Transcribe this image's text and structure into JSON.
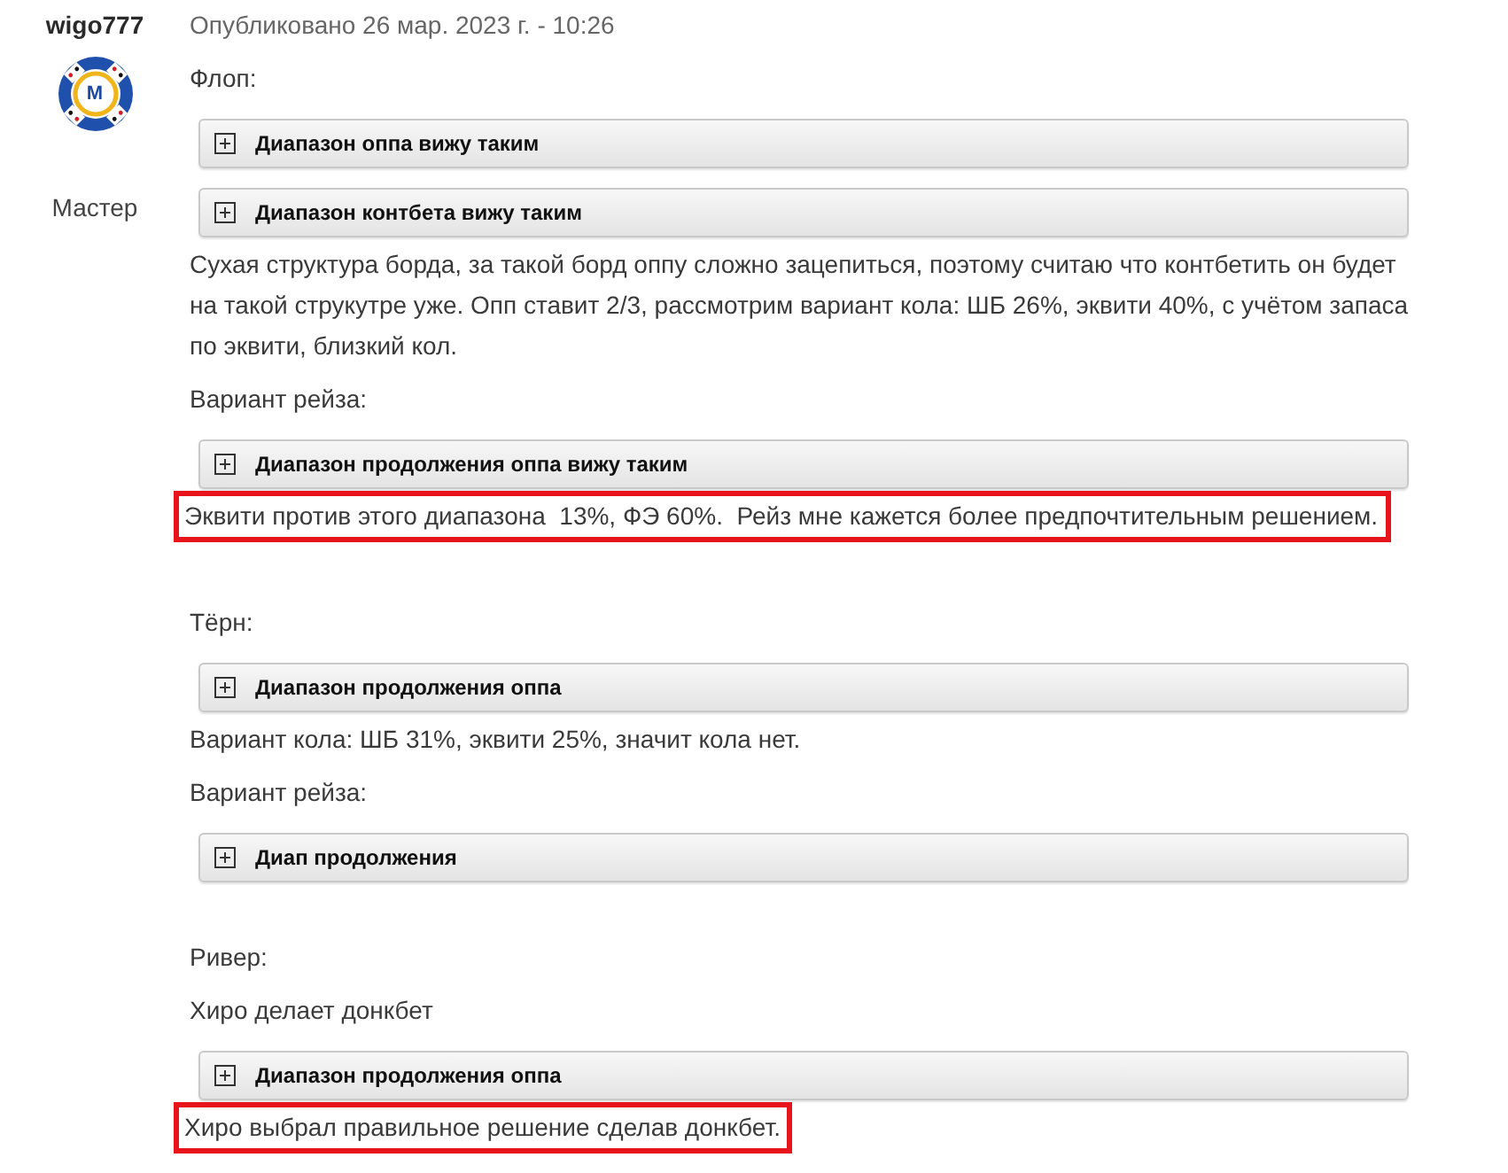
{
  "post": {
    "author": {
      "username": "wigo777",
      "avatar_letter": "M",
      "rank": "Мастер"
    },
    "published": "Опубликовано 26 мар. 2023 г. - 10:26",
    "blocks": [
      {
        "kind": "text",
        "text": "Флоп:",
        "highlighted": false
      },
      {
        "kind": "spoiler",
        "title": "Диапазон оппа вижу таким",
        "expanded": false
      },
      {
        "kind": "spoiler",
        "title": "Диапазон контбета вижу таким",
        "expanded": false
      },
      {
        "kind": "text",
        "text": "Сухая структура борда, за такой борд оппу сложно зацепиться, поэтому считаю что контбетить он будет на такой струкутре уже. Опп ставит 2/3, рассмотрим вариант кола: ШБ 26%, эквити 40%, с учётом запаса по эквити, близкий кол.",
        "highlighted": false
      },
      {
        "kind": "text",
        "text": "Вариант рейза:",
        "highlighted": false
      },
      {
        "kind": "spoiler",
        "title": "Диапазон продолжения оппа вижу таким",
        "expanded": false
      },
      {
        "kind": "text",
        "text": "Эквити против этого диапазона  13%, ФЭ 60%.  Рейз мне кажется более предпочтительным решением.",
        "highlighted": true
      },
      {
        "kind": "blank"
      },
      {
        "kind": "text",
        "text": "Тёрн:",
        "highlighted": false
      },
      {
        "kind": "spoiler",
        "title": "Диапазон продолжения оппа",
        "expanded": false
      },
      {
        "kind": "text",
        "text": "Вариант кола: ШБ 31%, эквити 25%, значит кола нет.",
        "highlighted": false
      },
      {
        "kind": "text",
        "text": "Вариант рейза:",
        "highlighted": false
      },
      {
        "kind": "spoiler",
        "title": "Диап продолжения",
        "expanded": false
      },
      {
        "kind": "blank"
      },
      {
        "kind": "text",
        "text": "Ривер:",
        "highlighted": false
      },
      {
        "kind": "text",
        "text": "Хиро делает донкбет",
        "highlighted": false
      },
      {
        "kind": "spoiler",
        "title": "Диапазон продолжения оппа",
        "expanded": false
      },
      {
        "kind": "text",
        "text": "Хиро выбрал правильное решение сделав донкбет.",
        "highlighted": true
      }
    ]
  }
}
